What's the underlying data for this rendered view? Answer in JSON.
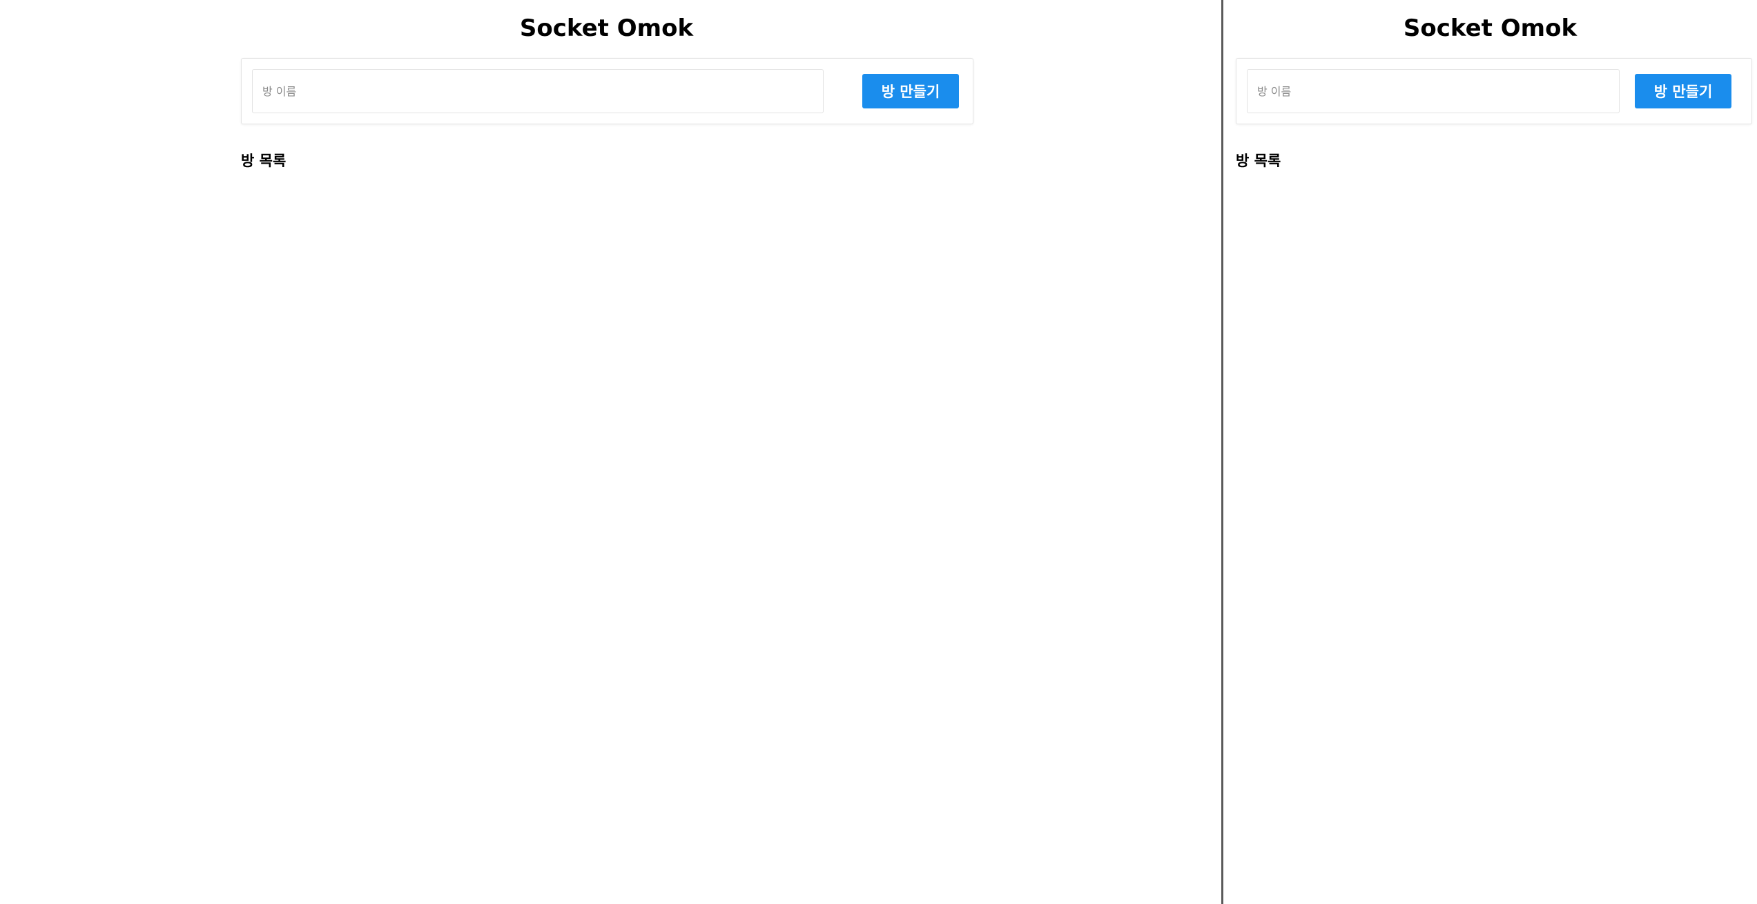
{
  "panes": [
    {
      "title": "Socket Omok",
      "create_form": {
        "input_value": "",
        "input_placeholder": "방 이름",
        "button_label": "방 만들기"
      },
      "room_list": {
        "title": "방 목록",
        "rooms": []
      }
    },
    {
      "title": "Socket Omok",
      "create_form": {
        "input_value": "",
        "input_placeholder": "방 이름",
        "button_label": "방 만들기"
      },
      "room_list": {
        "title": "방 목록",
        "rooms": []
      }
    }
  ],
  "colors": {
    "primary_button": "#1a8ded",
    "divider": "#5a5a5a"
  }
}
